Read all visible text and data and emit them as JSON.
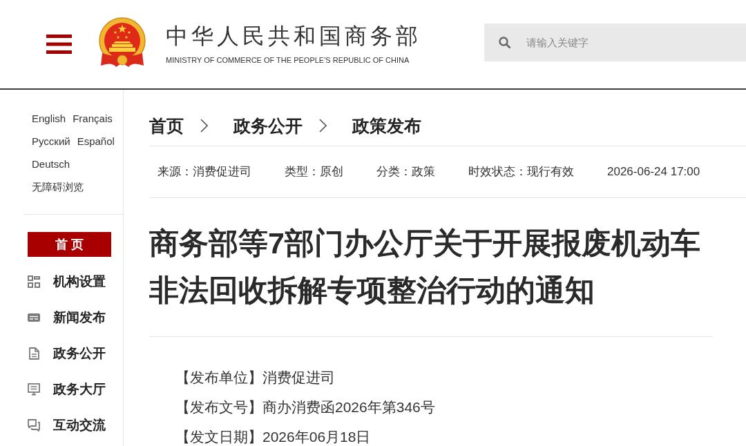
{
  "header": {
    "title": "中华人民共和国商务部",
    "subtitle": "MINISTRY OF COMMERCE OF THE PEOPLE'S REPUBLIC OF CHINA",
    "search": {
      "placeholder": "请输入关键字"
    }
  },
  "sidebar": {
    "language_rows": [
      [
        "English",
        "Français"
      ],
      [
        "Русский",
        "Español"
      ],
      [
        "Deutsch"
      ],
      [
        "无障碍浏览"
      ]
    ],
    "nav": [
      {
        "label": "首 页",
        "kind": "button"
      },
      {
        "label": "机构设置",
        "kind": "link"
      },
      {
        "label": "新闻发布",
        "kind": "link"
      },
      {
        "label": "政务公开",
        "kind": "link"
      },
      {
        "label": "政务大厅",
        "kind": "link"
      },
      {
        "label": "互动交流",
        "kind": "link"
      }
    ]
  },
  "breadcrumb": [
    "首页",
    "政务公开",
    "政策发布"
  ],
  "meta": [
    "来源：消费促进司",
    "类型：原创",
    "分类：政策",
    "时效状态：现行有效",
    "2026-06-24 17:00"
  ],
  "article": {
    "title": "商务部等7部门办公厅关于开展报废机动车非法回收拆解专项整治行动的通知",
    "details": [
      "【发布单位】消费促进司",
      "【发布文号】商办消费函2026年第346号",
      "【发文日期】2026年06月18日"
    ]
  }
}
